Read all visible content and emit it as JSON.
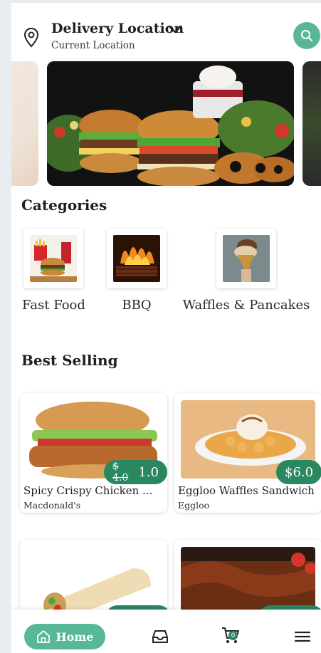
{
  "header": {
    "title": "Delivery Location",
    "subtitle": "Current Location",
    "pin_icon": "map-pin-icon",
    "dropdown_icon": "chevron-down-icon",
    "search_icon": "search-icon"
  },
  "colors": {
    "accent": "#58b896",
    "price_pill": "#2a8760",
    "background": "#ffffff"
  },
  "categories": {
    "title": "Categories",
    "items": [
      {
        "label": "Fast Food",
        "icon": "fast-food-image"
      },
      {
        "label": "BBQ",
        "icon": "bbq-image"
      },
      {
        "label": "Waffles & Pancakes",
        "icon": "ice-cream-waffle-image"
      }
    ]
  },
  "best_selling": {
    "title": "Best Selling",
    "products": [
      {
        "name": "Spicy Crispy Chicken ...",
        "shop": "Macdonald's",
        "old_price": "$ 4.0",
        "price": "1.0"
      },
      {
        "name": "Eggloo Waffles Sandwich",
        "shop": "Eggloo",
        "price": "$6.0"
      },
      {
        "name": "",
        "shop": ""
      },
      {
        "name": "",
        "shop": ""
      }
    ]
  },
  "bottom_nav": {
    "home_label": "Home",
    "home_icon": "home-icon",
    "orders_icon": "inbox-icon",
    "cart_icon": "cart-icon",
    "cart_count": "0",
    "menu_icon": "menu-icon"
  }
}
